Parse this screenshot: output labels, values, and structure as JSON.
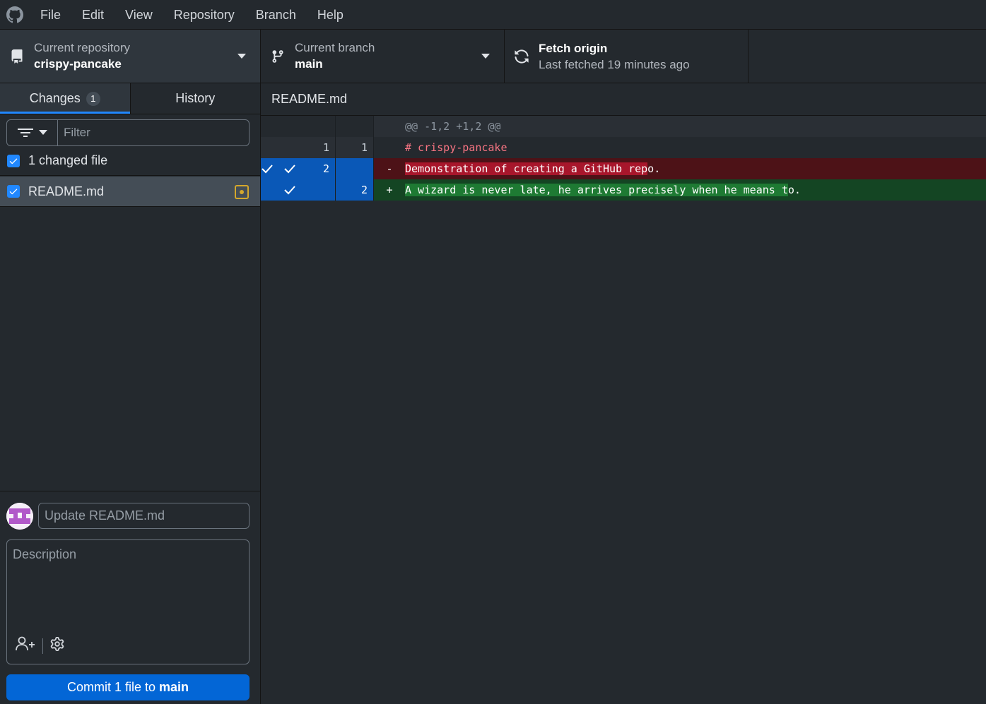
{
  "menu": [
    "File",
    "Edit",
    "View",
    "Repository",
    "Branch",
    "Help"
  ],
  "toolbar": {
    "repo_label": "Current repository",
    "repo_value": "crispy-pancake",
    "branch_label": "Current branch",
    "branch_value": "main",
    "fetch_title": "Fetch origin",
    "fetch_subtitle": "Last fetched 19 minutes ago"
  },
  "tabs": {
    "changes": "Changes",
    "changes_count": "1",
    "history": "History"
  },
  "filter": {
    "placeholder": "Filter"
  },
  "changes": {
    "header": "1 changed file",
    "files": [
      {
        "name": "README.md",
        "status": "modified",
        "checked": true
      }
    ]
  },
  "commit": {
    "summary_placeholder": "Update README.md",
    "description_placeholder": "Description",
    "button_prefix": "Commit 1 file to",
    "button_branch": "main"
  },
  "diff": {
    "file": "README.md",
    "hunk": "@@ -1,2 +1,2 @@",
    "lines": [
      {
        "type": "context",
        "old": "1",
        "new": "1",
        "sign": "",
        "text": "# crispy-pancake"
      },
      {
        "type": "deleted",
        "old": "2",
        "new": "",
        "sign": "-",
        "text_hl": "Demonstration of creating a GitHub rep",
        "text_rest": "o."
      },
      {
        "type": "added",
        "old": "",
        "new": "2",
        "sign": "+",
        "text_hl": "A wizard is never late, he arrives precisely when he means t",
        "text_rest": "o."
      }
    ]
  },
  "colors": {
    "accent": "#2188ff",
    "commit_button": "#0366d6",
    "deleted_bg": "#4d1217",
    "added_bg": "#144523",
    "modified_status": "#d4a72c"
  }
}
